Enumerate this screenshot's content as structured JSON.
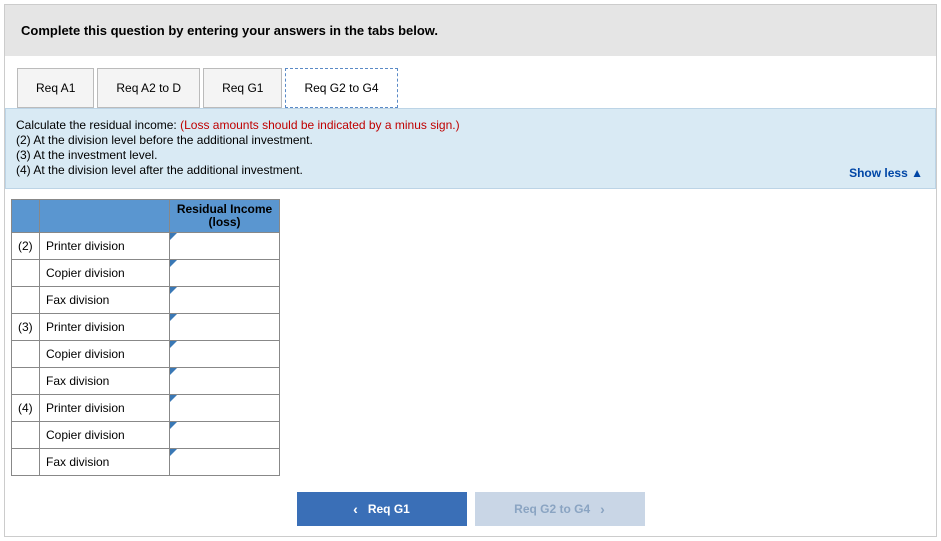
{
  "header": {
    "title": "Complete this question by entering your answers in the tabs below."
  },
  "tabs": [
    {
      "label": "Req A1"
    },
    {
      "label": "Req A2 to D"
    },
    {
      "label": "Req G1"
    },
    {
      "label": "Req G2 to G4"
    }
  ],
  "panel": {
    "intro": "Calculate the residual income: ",
    "hint": "(Loss amounts should be indicated by a minus sign.)",
    "lines": [
      "(2) At the division level before the additional investment.",
      "(3) At the investment level.",
      "(4) At the division level after the additional investment."
    ],
    "toggle": "Show less"
  },
  "table": {
    "header_col2": "Residual Income (loss)",
    "rows": [
      {
        "num": "(2)",
        "label": "Printer division",
        "value": ""
      },
      {
        "num": "",
        "label": "Copier division",
        "value": ""
      },
      {
        "num": "",
        "label": "Fax division",
        "value": ""
      },
      {
        "num": "(3)",
        "label": "Printer division",
        "value": ""
      },
      {
        "num": "",
        "label": "Copier division",
        "value": ""
      },
      {
        "num": "",
        "label": "Fax division",
        "value": ""
      },
      {
        "num": "(4)",
        "label": "Printer division",
        "value": ""
      },
      {
        "num": "",
        "label": "Copier division",
        "value": ""
      },
      {
        "num": "",
        "label": "Fax division",
        "value": ""
      }
    ]
  },
  "footer": {
    "prev": "Req G1",
    "next": "Req G2 to G4"
  }
}
